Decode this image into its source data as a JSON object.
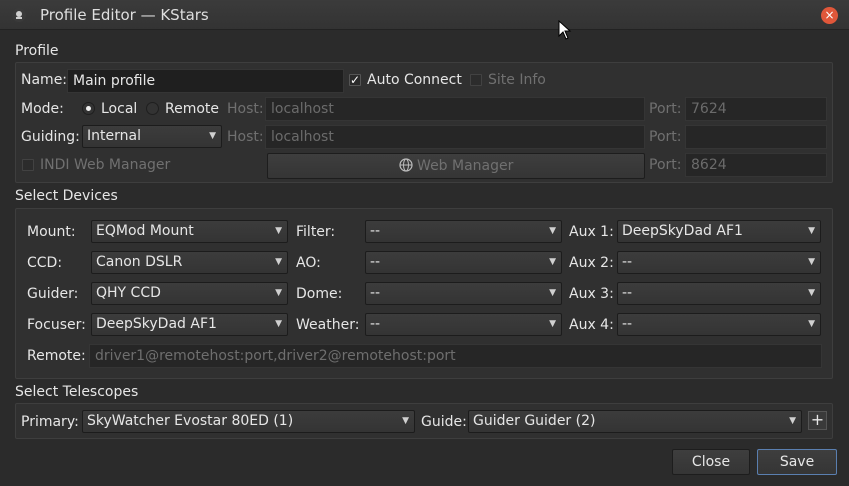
{
  "window": {
    "title": "Profile Editor — KStars",
    "close_glyph": "×"
  },
  "profile": {
    "group_title": "Profile",
    "name_label": "Name:",
    "name_value": "Main profile",
    "auto_connect_label": "Auto Connect",
    "auto_connect_checked": "✓",
    "site_info_label": "Site Info",
    "mode_label": "Mode:",
    "mode_local": "Local",
    "mode_remote": "Remote",
    "host_label": "Host:",
    "host1_value": "localhost",
    "port_label": "Port:",
    "port1_value": "7624",
    "guiding_label": "Guiding:",
    "guiding_value": "Internal",
    "host2_value": "localhost",
    "port2_value": "",
    "indi_web_manager_label": "INDI Web Manager",
    "web_manager_button": "Web Manager",
    "port3_value": "8624"
  },
  "devices": {
    "group_title": "Select Devices",
    "mount_label": "Mount:",
    "mount_value": "EQMod Mount",
    "ccd_label": "CCD:",
    "ccd_value": "Canon DSLR",
    "guider_label": "Guider:",
    "guider_value": "QHY CCD",
    "focuser_label": "Focuser:",
    "focuser_value": "DeepSkyDad AF1",
    "filter_label": "Filter:",
    "filter_value": "--",
    "ao_label": "AO:",
    "ao_value": "--",
    "dome_label": "Dome:",
    "dome_value": "--",
    "weather_label": "Weather:",
    "weather_value": "--",
    "aux1_label": "Aux 1:",
    "aux1_value": "DeepSkyDad AF1",
    "aux2_label": "Aux 2:",
    "aux2_value": "--",
    "aux3_label": "Aux 3:",
    "aux3_value": "--",
    "aux4_label": "Aux 4:",
    "aux4_value": "--",
    "remote_label": "Remote:",
    "remote_placeholder": "driver1@remotehost:port,driver2@remotehost:port"
  },
  "telescopes": {
    "group_title": "Select Telescopes",
    "primary_label": "Primary:",
    "primary_value": "SkyWatcher Evostar 80ED (1)",
    "guide_label": "Guide:",
    "guide_value": "Guider Guider (2)",
    "add_glyph": "+"
  },
  "footer": {
    "close_label": "Close",
    "save_label": "Save"
  },
  "icons": {
    "combo_arrow": "▼",
    "globe": "🌐"
  },
  "colors": {
    "close_button": "#e0573a",
    "save_border": "#5a7fb0",
    "background": "#2b2b2b"
  }
}
